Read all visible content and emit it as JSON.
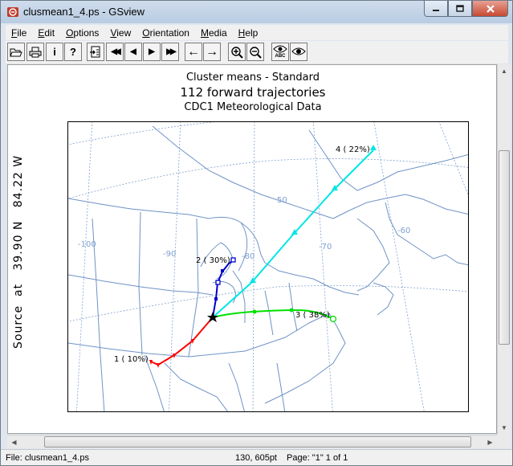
{
  "window": {
    "title": "clusmean1_4.ps - GSview",
    "minimize_icon": "minimize-icon",
    "maximize_icon": "maximize-icon",
    "close_icon": "close-icon"
  },
  "menu": [
    {
      "label": "File",
      "accel": "F",
      "rest": "ile"
    },
    {
      "label": "Edit",
      "accel": "E",
      "rest": "dit"
    },
    {
      "label": "Options",
      "accel": "O",
      "rest": "ptions"
    },
    {
      "label": "View",
      "accel": "V",
      "rest": "iew"
    },
    {
      "label": "Orientation",
      "accel": "O",
      "rest": "rientation"
    },
    {
      "label": "Media",
      "accel": "M",
      "rest": "edia"
    },
    {
      "label": "Help",
      "accel": "H",
      "rest": "elp"
    }
  ],
  "toolbar": {
    "buttons": [
      {
        "name": "open-file-button",
        "icon": "folder-open-icon"
      },
      {
        "name": "print-button",
        "icon": "printer-icon"
      },
      {
        "name": "info-button",
        "icon": "info-icon",
        "glyph": "i"
      },
      {
        "name": "help-button",
        "icon": "help-icon",
        "glyph": "?"
      },
      {
        "name": "goto-page-button",
        "icon": "goto-page-icon"
      },
      {
        "name": "skip-back-button",
        "icon": "double-left-icon",
        "glyph": "◀◀"
      },
      {
        "name": "prev-page-button",
        "icon": "left-triangle-icon",
        "glyph": "◀"
      },
      {
        "name": "next-page-button",
        "icon": "right-triangle-icon",
        "glyph": "▶"
      },
      {
        "name": "skip-forward-button",
        "icon": "double-right-icon",
        "glyph": "▶▶"
      },
      {
        "name": "back-button",
        "icon": "arrow-left-icon",
        "glyph": "←"
      },
      {
        "name": "forward-button",
        "icon": "arrow-right-icon",
        "glyph": "→"
      },
      {
        "name": "zoom-in-button",
        "icon": "zoom-in-icon"
      },
      {
        "name": "zoom-out-button",
        "icon": "zoom-out-icon"
      },
      {
        "name": "text-extract-button",
        "icon": "eye-abc-icon",
        "caption": "ABC"
      },
      {
        "name": "show-button",
        "icon": "eye-icon"
      }
    ]
  },
  "document": {
    "title_line1": "Cluster means - Standard",
    "title_line2": "112 forward trajectories",
    "title_line3": "CDC1 Meteorological Data",
    "source_label": "Source  at   39.90 N   84.22 W",
    "longitude_labels": [
      "-100",
      "-90",
      "-80",
      "-70",
      "-60"
    ],
    "latitude_labels": [
      "50"
    ],
    "clusters": [
      {
        "label": "1 ( 10%)",
        "color": "#ff0000",
        "marker": "triangle-down"
      },
      {
        "label": "2 ( 30%)",
        "color": "#0000cc",
        "marker": "square"
      },
      {
        "label": "3 ( 38%)",
        "color": "#00e000",
        "marker": "circle"
      },
      {
        "label": "4 ( 22%)",
        "color": "#00e5e5",
        "marker": "triangle-up"
      }
    ],
    "source_marker": "star-icon",
    "map_line_color": "#6f93c6"
  },
  "status": {
    "file": "File: clusmean1_4.ps",
    "coords": "130, 605pt",
    "page": "Page: \"1\"  1 of 1"
  }
}
